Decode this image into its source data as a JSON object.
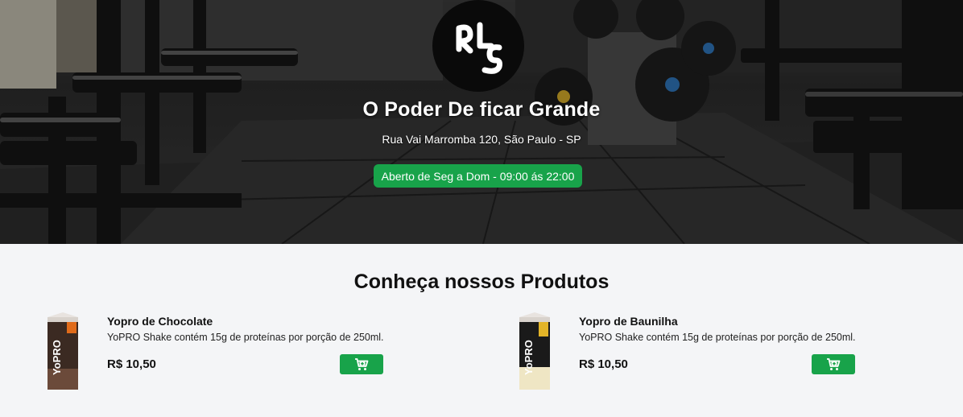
{
  "hero": {
    "title": "O Poder De ficar Grande",
    "address": "Rua Vai Marromba 120, São Paulo - SP",
    "hours": "Aberto de Seg a Dom - 09:00 ás 22:00"
  },
  "logo": {
    "icon": "rls-logo-icon"
  },
  "products_section": {
    "title": "Conheça nossos Produtos",
    "items": [
      {
        "name": "Yopro de Chocolate",
        "description": "YoPRO Shake contém 15g de proteínas por porção de 250ml.",
        "price": "R$ 10,50",
        "image_icon": "yopro-chocolate-carton-icon",
        "brand_text": "YoPRO",
        "cart_icon": "cart-plus-icon"
      },
      {
        "name": "Yopro de Baunilha",
        "description": "YoPRO Shake contém 15g de proteínas por porção de 250ml.",
        "price": "R$ 10,50",
        "image_icon": "yopro-vanilla-carton-icon",
        "brand_text": "YoPRO",
        "cart_icon": "cart-plus-icon"
      }
    ]
  },
  "colors": {
    "accent_green": "#18a34a",
    "page_background": "#f4f5f7",
    "logo_background": "#0a0a0a"
  }
}
